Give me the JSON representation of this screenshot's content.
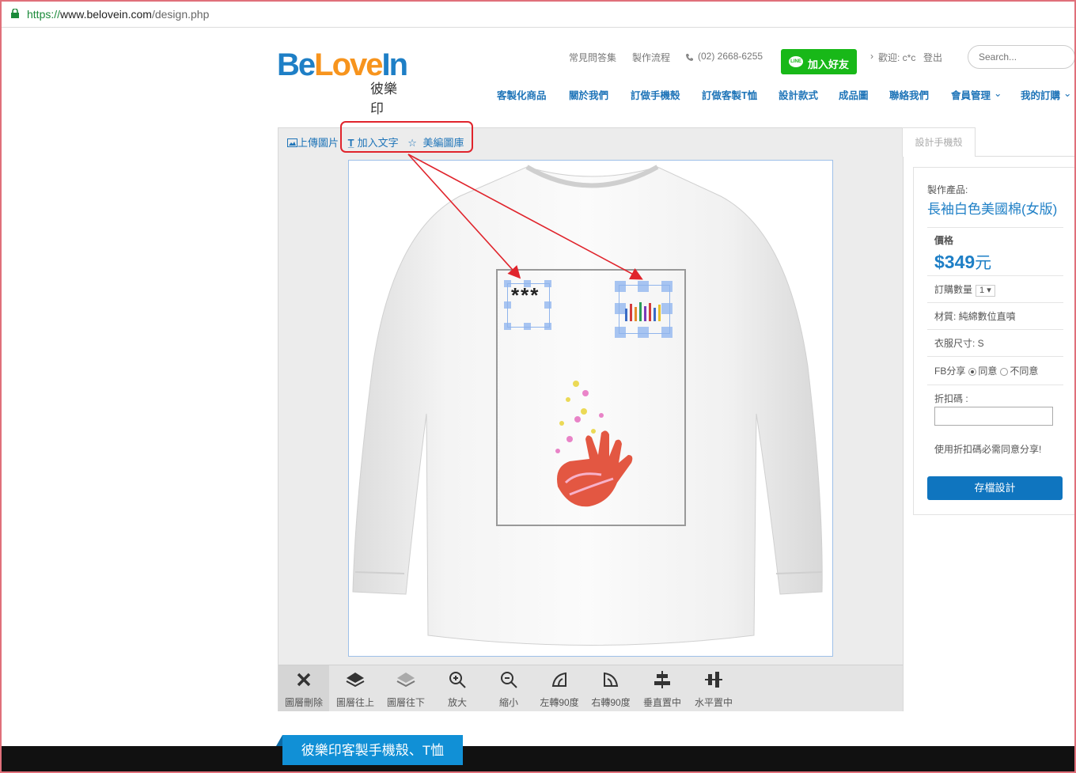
{
  "browser": {
    "url_protocol": "https://",
    "url_host": "www.belovein.com",
    "url_path": "/design.php"
  },
  "header": {
    "logo_be": "Be",
    "logo_love": "Love",
    "logo_in": "In",
    "logo_cn": "彼樂印",
    "top_links": [
      "常見問答集",
      "製作流程"
    ],
    "phone": "(02) 2668-6255",
    "line_button": "加入好友",
    "line_icon_text": "LINE",
    "welcome": "歡迎: c*c",
    "logout": "登出",
    "search_placeholder": "Search..."
  },
  "nav": [
    "客製化商品",
    "關於我們",
    "訂做手機殼",
    "訂做客製T恤",
    "設計款式",
    "成品圖",
    "聯絡我們",
    "會員管理",
    "我的訂購"
  ],
  "designer": {
    "toolbar": {
      "upload": "上傳圖片",
      "add_text": "加入文字",
      "gallery": "美編圖庫"
    },
    "text_layer": "***",
    "tools": [
      "圖層刪除",
      "圖層往上",
      "圖層往下",
      "放大",
      "縮小",
      "左轉90度",
      "右轉90度",
      "垂直置中",
      "水平置中"
    ]
  },
  "panel": {
    "tab": "設計手機殼",
    "product_label": "製作產品:",
    "product_name": "長袖白色美國棉(女版)",
    "price_label": "價格",
    "price_amount": "$349",
    "price_unit": "元",
    "qty_label": "訂購數量",
    "qty_value": "1",
    "material": "材質: 純綿數位直噴",
    "size": "衣服尺寸: S",
    "fb_label": "FB分享",
    "fb_agree": "同意",
    "fb_disagree": "不同意",
    "coupon_label": "折扣碼 :",
    "coupon_note": "使用折扣碼必需同意分享!",
    "save_button": "存檔設計"
  },
  "footer": {
    "tab": "彼樂印客製手機殼、T恤"
  },
  "colors": {
    "brand_blue": "#1e7fc6",
    "brand_orange": "#f7941d",
    "line_green": "#18b818",
    "annotation_red": "#e0242c"
  }
}
